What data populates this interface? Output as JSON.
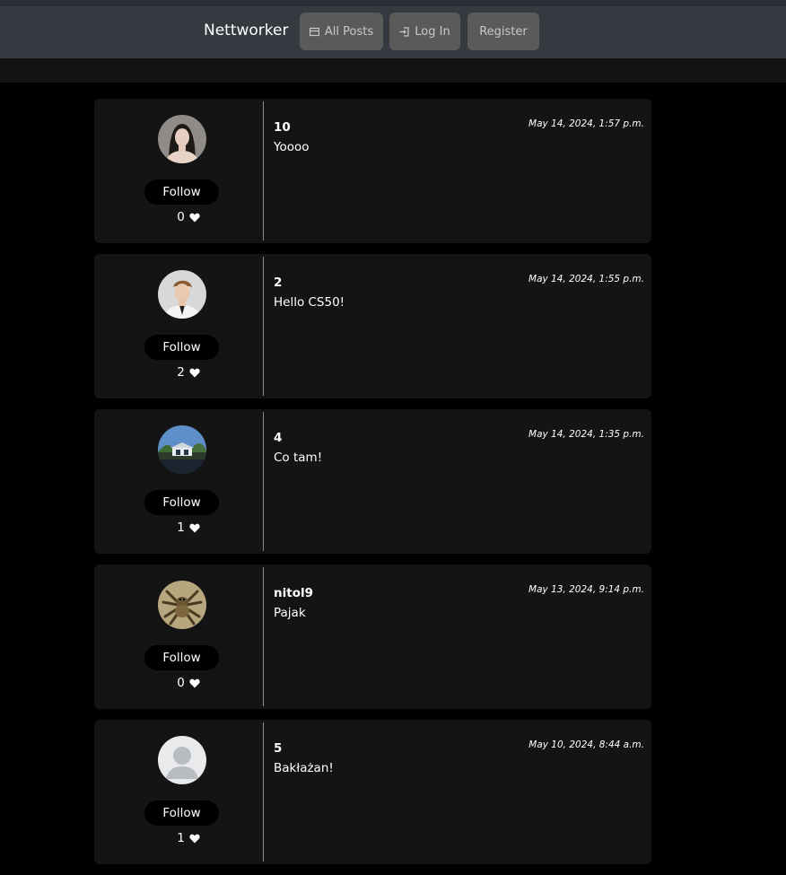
{
  "navbar": {
    "brand": "Nettworker",
    "all_posts_label": "All Posts",
    "all_posts_icon": "posts-icon",
    "login_label": "Log In",
    "login_icon": "login-icon",
    "register_label": "Register"
  },
  "posts": [
    {
      "username": "10",
      "content": "Yoooo",
      "timestamp": "May 14, 2024, 1:57 p.m.",
      "follow_label": "Follow",
      "likes": "0",
      "avatar": "woman-portrait-avatar"
    },
    {
      "username": "2",
      "content": "Hello CS50!",
      "timestamp": "May 14, 2024, 1:55 p.m.",
      "follow_label": "Follow",
      "likes": "2",
      "avatar": "man-portrait-avatar"
    },
    {
      "username": "4",
      "content": "Co tam!",
      "timestamp": "May 14, 2024, 1:35 p.m.",
      "follow_label": "Follow",
      "likes": "1",
      "avatar": "house-photo-avatar"
    },
    {
      "username": "nitol9",
      "content": "Pajak",
      "timestamp": "May 13, 2024, 9:14 p.m.",
      "follow_label": "Follow",
      "likes": "0",
      "avatar": "spider-photo-avatar"
    },
    {
      "username": "5",
      "content": "Bakłażan!",
      "timestamp": "May 10, 2024, 8:44 a.m.",
      "follow_label": "Follow",
      "likes": "1",
      "avatar": "default-user-avatar"
    }
  ],
  "colors": {
    "page_background": "#000000",
    "navbar_background": "#343a40",
    "nav_button_background": "#5a5a5a",
    "post_background": "#141414",
    "follow_button_background": "#000000"
  }
}
